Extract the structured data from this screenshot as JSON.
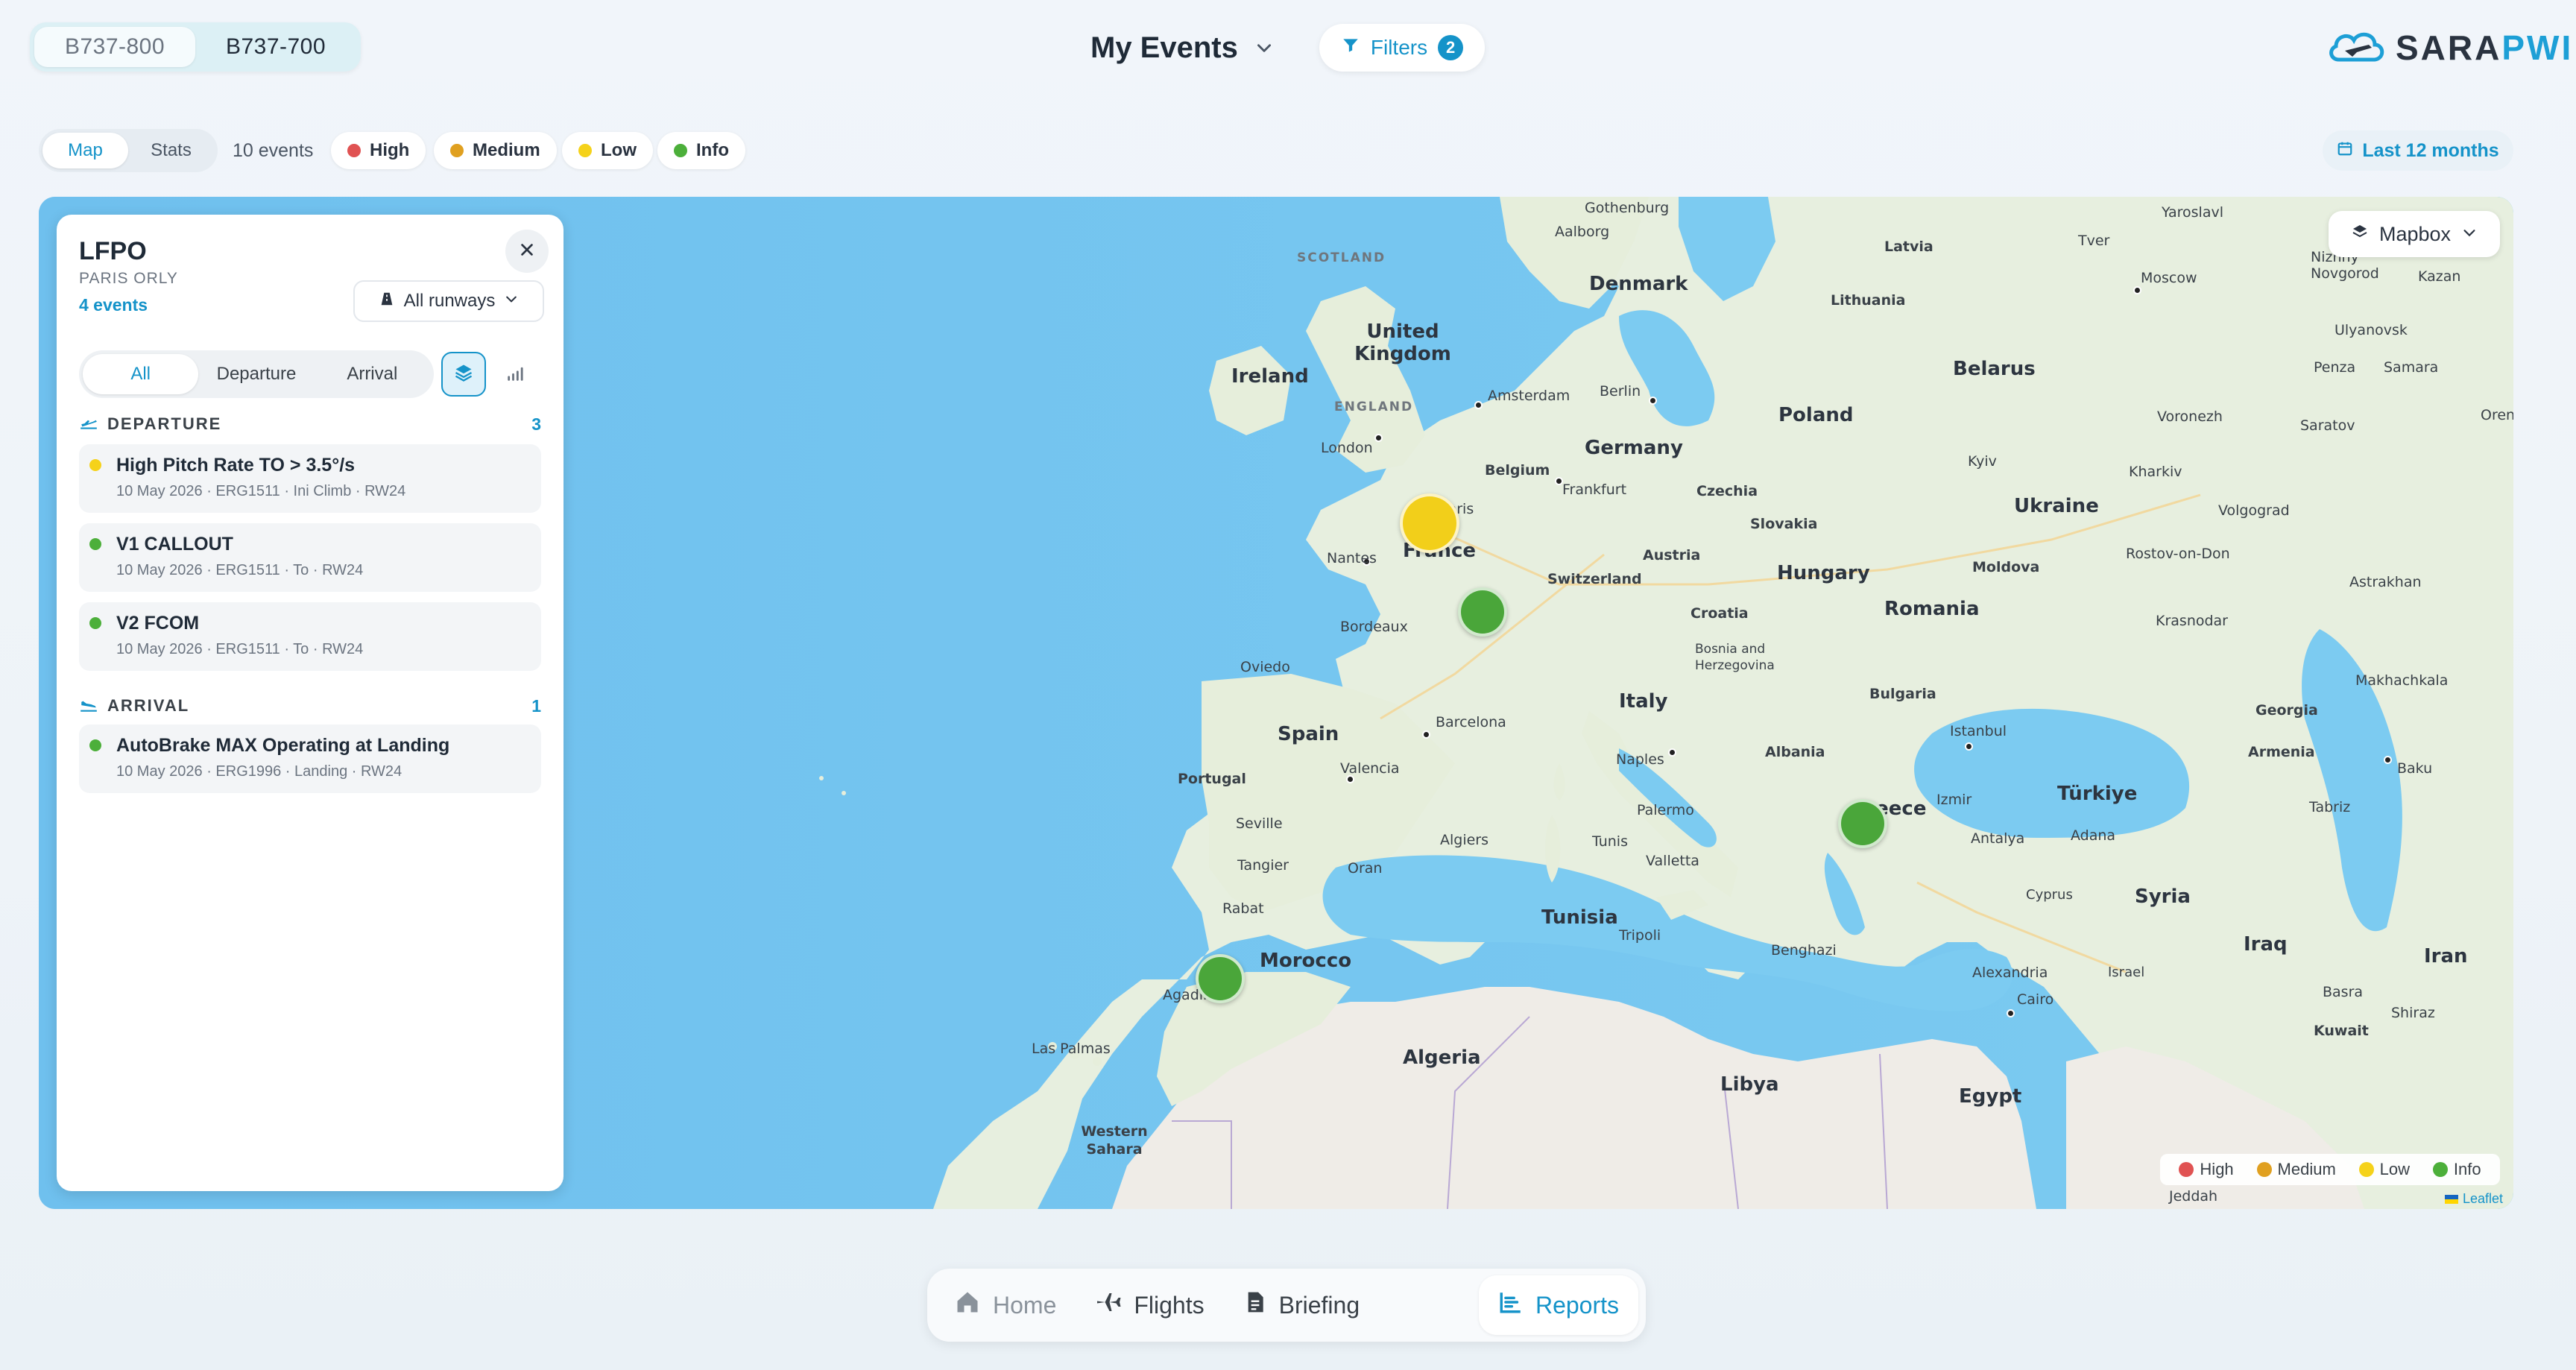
{
  "aircraft": {
    "options": [
      "B737-800",
      "B737-700"
    ],
    "selected": "B737-700"
  },
  "header": {
    "title": "My Events",
    "filters_label": "Filters",
    "filters_count": "2"
  },
  "logo": {
    "part1": "SARA",
    "part2": "PWI"
  },
  "toolbar": {
    "views": [
      "Map",
      "Stats"
    ],
    "active_view": "Map",
    "event_count": "10 events",
    "severities": [
      {
        "label": "High",
        "color": "#e05252"
      },
      {
        "label": "Medium",
        "color": "#e0a020"
      },
      {
        "label": "Low",
        "color": "#f5d21a"
      },
      {
        "label": "Info",
        "color": "#4caf3a"
      }
    ],
    "period": "Last 12 months"
  },
  "map": {
    "provider": "Mapbox",
    "attribution": "Leaflet",
    "legend": [
      "High",
      "Medium",
      "Low",
      "Info"
    ],
    "countries": [
      "Denmark",
      "United Kingdom",
      "Ireland",
      "Poland",
      "Belarus",
      "Germany",
      "Belgium",
      "Czechia",
      "Slovakia",
      "Ukraine",
      "France",
      "Switzerland",
      "Austria",
      "Hungary",
      "Moldova",
      "Romania",
      "Croatia",
      "Bosnia and Herzegovina",
      "Italy",
      "Bulgaria",
      "Spain",
      "Portugal",
      "Albania",
      "Greece",
      "Türkiye",
      "Georgia",
      "Armenia",
      "Syria",
      "Iraq",
      "Iran",
      "Kuwait",
      "Tunisia",
      "Morocco",
      "Algeria",
      "Libya",
      "Egypt",
      "Western Sahara",
      "Cyprus",
      "Israel",
      "Latvia",
      "Lithuania"
    ],
    "regions": [
      "SCOTLAND",
      "ENGLAND"
    ],
    "cities": [
      "Gothenburg",
      "Aalborg",
      "Yaroslavl",
      "Tver",
      "Nizhny Novgorod",
      "Kazan",
      "Moscow",
      "Ulyanovsk",
      "Penza",
      "Samara",
      "Orenburg",
      "Voronezh",
      "Saratov",
      "Amsterdam",
      "Berlin",
      "London",
      "Frankfurt",
      "Paris",
      "Nantes",
      "Bordeaux",
      "Kyiv",
      "Kharkiv",
      "Volgograd",
      "Rostov-on-Don",
      "Astrakhan",
      "Krasnodar",
      "Makhachkala",
      "Baku",
      "Tabriz",
      "Oviedo",
      "Barcelona",
      "Valencia",
      "Naples",
      "Istanbul",
      "Izmir",
      "Antalya",
      "Adana",
      "Palermo",
      "Tunis",
      "Valletta",
      "Seville",
      "Tangier",
      "Oran",
      "Algiers",
      "Rabat",
      "Tripoli",
      "Benghazi",
      "Alexandria",
      "Cairo",
      "Basra",
      "Shiraz",
      "Agadir",
      "Las Palmas",
      "Jeddah"
    ]
  },
  "panel": {
    "code": "LFPO",
    "name": "PARIS ORLY",
    "events_link": "4 events",
    "runway_select": "All runways",
    "phases": [
      "All",
      "Departure",
      "Arrival"
    ],
    "active_phase": "All",
    "sections": [
      {
        "label": "DEPARTURE",
        "count": "3",
        "events": [
          {
            "title": "High Pitch Rate TO > 3.5°/s",
            "meta": "10 May 2026 · ERG1511 · Ini Climb · RW24",
            "color": "#f5d21a"
          },
          {
            "title": "V1 CALLOUT",
            "meta": "10 May 2026 · ERG1511 · To · RW24",
            "color": "#4caf3a"
          },
          {
            "title": "V2 FCOM",
            "meta": "10 May 2026 · ERG1511 · To · RW24",
            "color": "#4caf3a"
          }
        ]
      },
      {
        "label": "ARRIVAL",
        "count": "1",
        "events": [
          {
            "title": "AutoBrake MAX Operating at Landing",
            "meta": "10 May 2026 · ERG1996 · Landing · RW24",
            "color": "#4caf3a"
          }
        ]
      }
    ]
  },
  "nav": {
    "items": [
      "Home",
      "Flights",
      "Briefing",
      "Reports"
    ],
    "active": "Reports"
  }
}
